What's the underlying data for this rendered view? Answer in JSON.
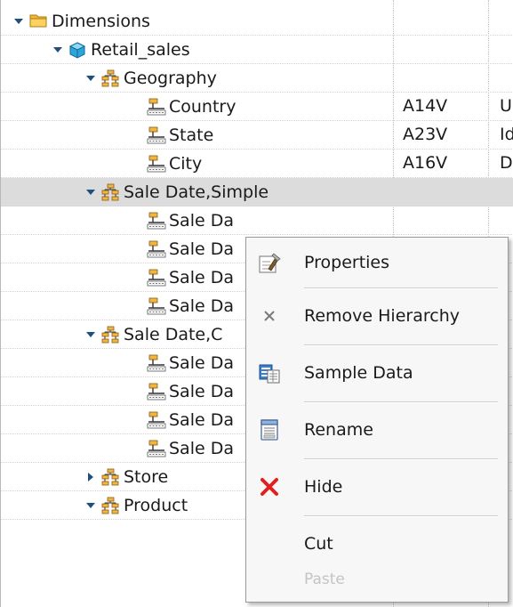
{
  "tree": {
    "rows": [
      {
        "label": "Dimensions",
        "code": "",
        "extra": "",
        "level": 0,
        "toggle": "expanded",
        "icon": "folder-icon"
      },
      {
        "label": "Retail_sales",
        "code": "",
        "extra": "",
        "level": 1,
        "toggle": "expanded",
        "icon": "cube-icon"
      },
      {
        "label": "Geography",
        "code": "",
        "extra": "",
        "level": 2,
        "toggle": "expanded",
        "icon": "hierarchy-icon"
      },
      {
        "label": "Country",
        "code": "A14V",
        "extra": "U",
        "level": 3,
        "toggle": "none",
        "icon": "level-icon"
      },
      {
        "label": "State",
        "code": "A23V",
        "extra": "Id",
        "level": 3,
        "toggle": "none",
        "icon": "level-icon"
      },
      {
        "label": "City",
        "code": "A16V",
        "extra": "D",
        "level": 3,
        "toggle": "none",
        "icon": "level-icon"
      },
      {
        "label": "Sale Date,Simple",
        "code": "",
        "extra": "",
        "level": 2,
        "toggle": "expanded",
        "icon": "hierarchy-icon",
        "selected": true
      },
      {
        "label": "Sale Da",
        "code": "",
        "extra": "",
        "level": 3,
        "toggle": "none",
        "icon": "level-icon"
      },
      {
        "label": "Sale Da",
        "code": "",
        "extra": "",
        "level": 3,
        "toggle": "none",
        "icon": "level-icon"
      },
      {
        "label": "Sale Da",
        "code": "",
        "extra": "",
        "level": 3,
        "toggle": "none",
        "icon": "level-icon"
      },
      {
        "label": "Sale Da",
        "code": "",
        "extra": "",
        "level": 3,
        "toggle": "none",
        "icon": "level-icon"
      },
      {
        "label": "Sale Date,C",
        "code": "",
        "extra": "",
        "level": 2,
        "toggle": "expanded",
        "icon": "hierarchy-icon"
      },
      {
        "label": "Sale Da",
        "code": "",
        "extra": "",
        "level": 3,
        "toggle": "none",
        "icon": "level-icon"
      },
      {
        "label": "Sale Da",
        "code": "",
        "extra": "",
        "level": 3,
        "toggle": "none",
        "icon": "level-icon"
      },
      {
        "label": "Sale Da",
        "code": "",
        "extra": "",
        "level": 3,
        "toggle": "none",
        "icon": "level-icon"
      },
      {
        "label": "Sale Da",
        "code": "",
        "extra": "",
        "level": 3,
        "toggle": "none",
        "icon": "level-icon"
      },
      {
        "label": "Store",
        "code": "",
        "extra": "",
        "level": 2,
        "toggle": "collapsed",
        "icon": "hierarchy-icon"
      },
      {
        "label": "Product",
        "code": "",
        "extra": "",
        "level": 2,
        "toggle": "expanded",
        "icon": "hierarchy-icon"
      }
    ]
  },
  "context_menu": {
    "items": [
      {
        "label": "Properties",
        "icon": "properties-icon",
        "enabled": true
      },
      {
        "label": "Remove Hierarchy",
        "icon": "remove-x-icon",
        "enabled": true
      },
      {
        "label": "Sample Data",
        "icon": "sample-data-icon",
        "enabled": true
      },
      {
        "label": "Rename",
        "icon": "rename-icon",
        "enabled": true
      },
      {
        "label": "Hide",
        "icon": "hide-x-icon",
        "enabled": true
      },
      {
        "label": "Cut",
        "icon": "",
        "enabled": true
      },
      {
        "label": "Paste",
        "icon": "",
        "enabled": false
      }
    ]
  },
  "colors": {
    "selected_row": "#dcdcdc",
    "menu_background": "#f7f7f7",
    "hide_icon": "#e02020",
    "folder_icon": "#f0b838",
    "cube_icon": "#2aa6dc",
    "hierarchy_icon": "#d98a14"
  }
}
